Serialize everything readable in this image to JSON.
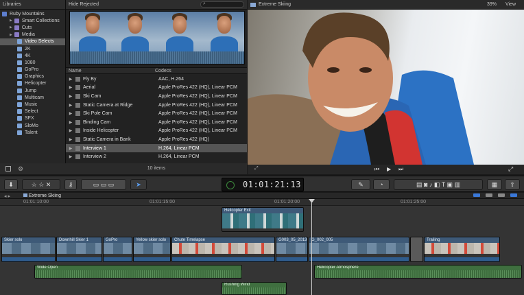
{
  "libraries": {
    "header": "Libraries",
    "items": [
      {
        "label": "Ruby Mountains",
        "indent": 0
      },
      {
        "label": "Smart Collections",
        "indent": 1
      },
      {
        "label": "Cuts",
        "indent": 1
      },
      {
        "label": "Media",
        "indent": 1
      },
      {
        "label": "Video Selects",
        "indent": 2
      },
      {
        "label": "2K",
        "indent": 2
      },
      {
        "label": "4K",
        "indent": 2
      },
      {
        "label": "1080",
        "indent": 2
      },
      {
        "label": "GoPro",
        "indent": 2
      },
      {
        "label": "Graphics",
        "indent": 2
      },
      {
        "label": "Helicopter",
        "indent": 2
      },
      {
        "label": "Jump",
        "indent": 2
      },
      {
        "label": "Multicam",
        "indent": 2
      },
      {
        "label": "Music",
        "indent": 2
      },
      {
        "label": "Select",
        "indent": 2
      },
      {
        "label": "SFX",
        "indent": 2
      },
      {
        "label": "SloMo",
        "indent": 2
      },
      {
        "label": "Talent",
        "indent": 2
      }
    ]
  },
  "browser": {
    "filter": "Hide Rejected",
    "columns": [
      "Name",
      "Codecs"
    ],
    "clips": [
      {
        "name": "Fly By",
        "codec": "AAC, H.264"
      },
      {
        "name": "Aerial",
        "codec": "Apple ProRes 422 (HQ), Linear PCM"
      },
      {
        "name": "Ski Cam",
        "codec": "Apple ProRes 422 (HQ), Linear PCM"
      },
      {
        "name": "Static Camera at Ridge",
        "codec": "Apple ProRes 422 (HQ), Linear PCM"
      },
      {
        "name": "Ski Pole Cam",
        "codec": "Apple ProRes 422 (HQ), Linear PCM"
      },
      {
        "name": "Binding Cam",
        "codec": "Apple ProRes 422 (HQ), Linear PCM"
      },
      {
        "name": "Inside Helicopter",
        "codec": "Apple ProRes 422 (HQ), Linear PCM"
      },
      {
        "name": "Static Camera in Bank",
        "codec": "Apple ProRes 422 (HQ)"
      },
      {
        "name": "Interview 1",
        "codec": "H.264, Linear PCM"
      },
      {
        "name": "Interview 2",
        "codec": "H.264, Linear PCM"
      }
    ],
    "footer": "10 items"
  },
  "viewer": {
    "title": "Extreme Skiing",
    "zoom": "39%",
    "view_menu": "View"
  },
  "toolbar": {
    "timecode": "01:01:21:13"
  },
  "timeline": {
    "project": "Extreme Skiing",
    "ruler": [
      "01:01:10:00",
      "01:01:15:00",
      "01:01:20:00",
      "01:01:25:00"
    ],
    "connected": "Helicopter Exit",
    "primary": [
      "Skier solo",
      "Downhill Skier 1",
      "GoPro",
      "Yellow skier solo",
      "Chute Timelapse",
      "G003_05_2013-01-29...",
      "G_002_005",
      "Trailing"
    ],
    "audio": [
      "Wide Open",
      "Helicopter Atmosphere",
      "Rushing Wind"
    ]
  },
  "colors": {
    "video_clip": "#3e5a78",
    "audio_clip": "#3f6f3f",
    "accent": "#3a78d8"
  }
}
